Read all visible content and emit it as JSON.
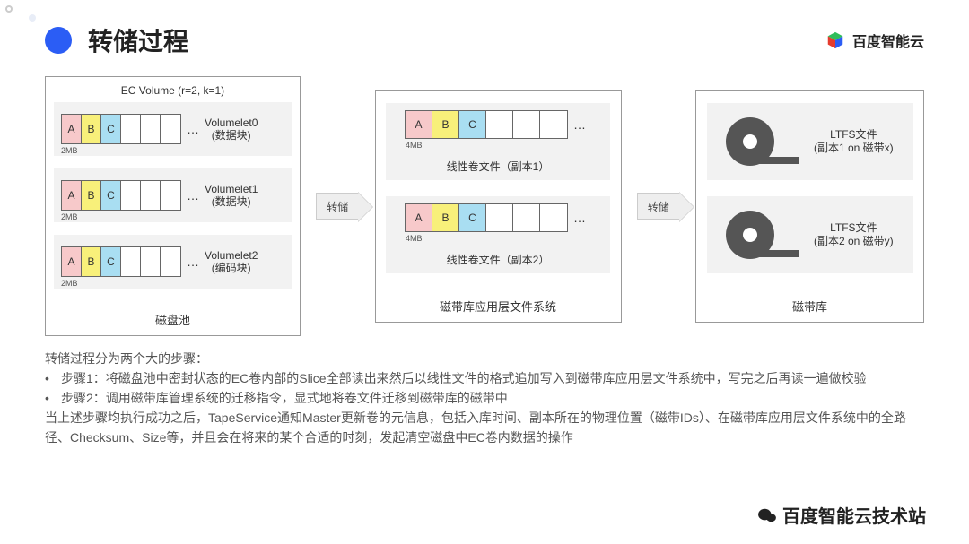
{
  "title": "转储过程",
  "logo_text": "百度智能云",
  "panel_a": {
    "title": "EC Volume (r=2, k=1)",
    "volumelets": [
      {
        "label_line1": "Volumelet0",
        "label_line2": "(数据块)",
        "size": "2MB"
      },
      {
        "label_line1": "Volumelet1",
        "label_line2": "(数据块)",
        "size": "2MB"
      },
      {
        "label_line1": "Volumelet2",
        "label_line2": "(编码块)",
        "size": "2MB"
      }
    ],
    "cells": [
      "A",
      "B",
      "C"
    ],
    "footer": "磁盘池"
  },
  "arrow_label": "转储",
  "panel_b": {
    "files": [
      {
        "label": "线性卷文件（副本1）",
        "size": "4MB"
      },
      {
        "label": "线性卷文件（副本2）",
        "size": "4MB"
      }
    ],
    "cells": [
      "A",
      "B",
      "C"
    ],
    "footer": "磁带库应用层文件系统"
  },
  "panel_c": {
    "tapes": [
      {
        "label_line1": "LTFS文件",
        "label_line2": "(副本1 on 磁带x)"
      },
      {
        "label_line1": "LTFS文件",
        "label_line2": "(副本2 on 磁带y)"
      }
    ],
    "footer": "磁带库"
  },
  "desc": {
    "l1": "转储过程分为两个大的步骤：",
    "l2": "步骤1：将磁盘池中密封状态的EC卷内部的Slice全部读出来然后以线性文件的格式追加写入到磁带库应用层文件系统中，写完之后再读一遍做校验",
    "l3": "步骤2：调用磁带库管理系统的迁移指令，显式地将卷文件迁移到磁带库的磁带中",
    "l4": "当上述步骤均执行成功之后，TapeService通知Master更新卷的元信息，包括入库时间、副本所在的物理位置（磁带IDs）、在磁带库应用层文件系统中的全路径、Checksum、Size等，并且会在将来的某个合适的时刻，发起清空磁盘中EC卷内数据的操作"
  },
  "watermark": "百度智能云技术站"
}
